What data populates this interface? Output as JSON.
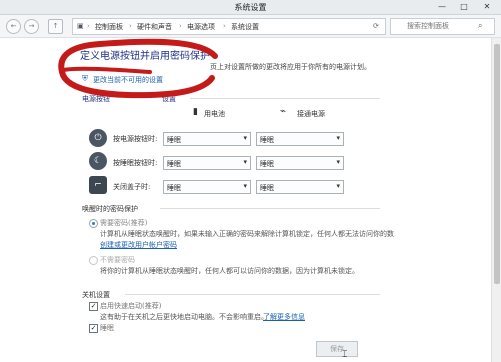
{
  "window": {
    "title": "系统设置",
    "minimize": "—",
    "maximize": "□",
    "close": "✕"
  },
  "nav": {
    "back": "←",
    "forward": "→",
    "up": "↑",
    "breadcrumb": [
      "控制面板",
      "硬件和声音",
      "电源选项",
      "系统设置"
    ],
    "separator": "›",
    "search_placeholder": "搜索控制面板"
  },
  "main": {
    "title": "定义电源按钮并启用密码保护",
    "desc_fragment": "页上对设置所做的更改将应用于你所有的电源计划。",
    "change_link": "更改当前不可用的设置",
    "section1": "电源按钮",
    "section1_tail": "设置",
    "columns": {
      "battery": "用电池",
      "plugged": "接通电源"
    },
    "rows": [
      {
        "label": "按电源按钮时:",
        "battery": "睡眠",
        "plugged": "睡眠"
      },
      {
        "label": "按睡眠按钮时:",
        "battery": "睡眠",
        "plugged": "睡眠"
      },
      {
        "label": "关闭盖子时:",
        "battery": "睡眠",
        "plugged": "睡眠"
      }
    ],
    "pw_section": "唤醒时的密码保护",
    "pw_require": {
      "label": "需要密码(推荐)",
      "desc1": "计算机从睡眠状态唤醒时，如果未输入正确的密码来解除计算机锁定，任何人都无法访问你的数",
      "link": "创建或更改用户帐户密码"
    },
    "pw_none": {
      "label": "不需要密码",
      "desc1": "将你的计算机从睡眠状态唤醒时，任何人都可以访问你的数据，因为计算机未锁定。"
    },
    "shutdown_section": "关机设置",
    "fast_startup": {
      "label": "启用快速启动(推荐)",
      "desc": "这有助于在关机之后更快地启动电脑。不会影响重启。",
      "link": "了解更多信息"
    },
    "sleep_opt": {
      "label": "睡眠"
    },
    "save_label": "保存",
    "check": "✓",
    "arrow": "▾"
  },
  "colors": {
    "annotation": "#c41a1a",
    "link": "#1a5fb4",
    "title": "#1e3287"
  }
}
